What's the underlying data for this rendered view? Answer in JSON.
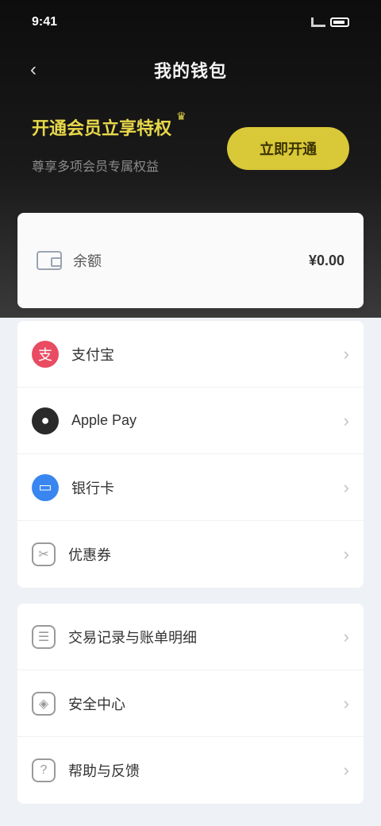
{
  "status_bar": {
    "time": "9:41"
  },
  "header": {
    "back_icon": "arrow-left-icon",
    "title": "我的钱包"
  },
  "membership": {
    "title": "开通会员立享特权",
    "subtitle": "尊享多项会员专属权益",
    "button_label": "立即开通",
    "accent_color": "#d9c837"
  },
  "balance": {
    "icon": "wallet-icon",
    "label": "余额",
    "value": "¥0.00"
  },
  "payment_methods": [
    {
      "label": "支付宝",
      "icon": "alipay-icon",
      "chevron": "›"
    },
    {
      "label": "Apple Pay",
      "icon": "apple-icon",
      "chevron": "›"
    },
    {
      "label": "银行卡",
      "icon": "bank-card-icon",
      "chevron": "›"
    },
    {
      "label": "优惠券",
      "icon": "coupon-icon",
      "chevron": "›"
    }
  ],
  "settings": [
    {
      "label": "交易记录与账单明细",
      "icon": "receipt-icon",
      "chevron": "›"
    },
    {
      "label": "安全中心",
      "icon": "shield-icon",
      "chevron": "›"
    },
    {
      "label": "帮助与反馈",
      "icon": "help-icon",
      "chevron": "›"
    }
  ]
}
